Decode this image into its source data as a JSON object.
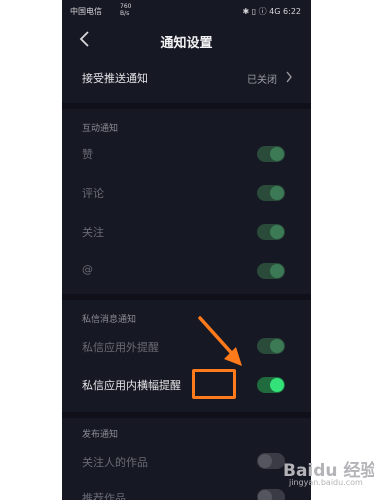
{
  "status_bar": {
    "carrier": "中国电信",
    "net_speed_top": "760",
    "net_speed_bottom": "B/s",
    "time": "6:22",
    "right_icons": "✱ ▯ ⓘ 4G"
  },
  "header": {
    "title": "通知设置"
  },
  "push": {
    "label": "接受推送通知",
    "value": "已关闭"
  },
  "sections": {
    "interaction": {
      "title": "互动通知",
      "items": [
        {
          "label": "赞",
          "state": "on"
        },
        {
          "label": "评论",
          "state": "on"
        },
        {
          "label": "关注",
          "state": "on"
        },
        {
          "label": "@",
          "state": "on"
        }
      ]
    },
    "private_message": {
      "title": "私信消息通知",
      "items": [
        {
          "label": "私信应用外提醒",
          "state": "on"
        },
        {
          "label": "私信应用内横幅提醒",
          "state": "on"
        }
      ]
    },
    "publish": {
      "title": "发布通知",
      "items": [
        {
          "label": "关注人的作品",
          "state": "off"
        },
        {
          "label": "推荐作品",
          "state": "off"
        }
      ]
    }
  },
  "watermark": {
    "brand": "Baidu 经验",
    "url": "jingyan.baidu.com"
  },
  "colors": {
    "background": "#161823",
    "toggle_on": "#34e27a",
    "highlight": "#ff7a1a"
  }
}
